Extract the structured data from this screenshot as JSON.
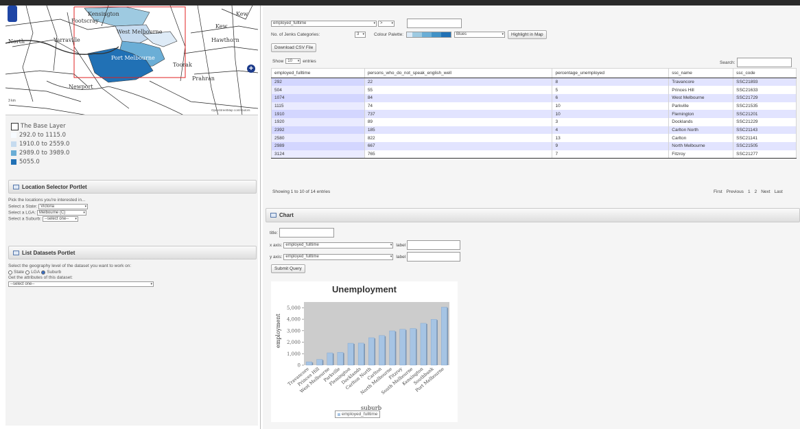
{
  "map": {
    "labels": {
      "kensington": "Kensington",
      "footscray": "Footscray",
      "kew": "Kew",
      "kew2": "Kew",
      "west_melbourne": "West Melbourne",
      "north": "North",
      "yarraville": "Yarraville",
      "hawthorn": "Hawthorn",
      "port_melbourne": "Port Melbourne",
      "toorak": "Toorak",
      "newport": "Newport",
      "prahran": "Prahran"
    },
    "scale_text": "3 km",
    "credit": "OpenStreetMap contributors",
    "zoom_label": "+"
  },
  "legend": {
    "base_layer": "The Base Layer",
    "items": [
      {
        "label": "292.0 to 1115.0",
        "color": "#f7fbff"
      },
      {
        "label": "1910.0 to 2559.0",
        "color": "#c6dbef"
      },
      {
        "label": "2989.0 to 3989.0",
        "color": "#6baed6"
      },
      {
        "label": "5055.0",
        "color": "#2171b5"
      }
    ]
  },
  "location_portlet": {
    "title": "Location Selector Portlet",
    "intro": "Pick the locations you're interested in...",
    "state_label": "Select a State:",
    "state_value": "Victoria",
    "lga_label": "Select a LGA:",
    "lga_value": "Melbourne (C)",
    "suburb_label": "Select a Suburb:",
    "suburb_value": "--select one--"
  },
  "datasets_portlet": {
    "title": "List Datasets Portlet",
    "intro": "Select the geography level of the dataset you want to work on:",
    "radio_state": "State",
    "radio_lga": "LGA",
    "radio_suburb": "Suburb",
    "attributes_label": "Get the attributes of this dataset:",
    "attributes_value": "--select one--"
  },
  "controls": {
    "attribute_value": "employed_fulltime",
    "operator_value": ">",
    "filter_value": "",
    "jenks_label": "No. of Jenks Categories:",
    "jenks_value": "3",
    "palette_label": "Colour Palette:",
    "palette_value": "Blues",
    "palette_colors": [
      "#deebf7",
      "#9ecae1",
      "#6baed6",
      "#4292c6",
      "#2171b5"
    ],
    "highlight_button": "Highlight in Map",
    "download_button": "Download CSV File",
    "show_label": "Show",
    "show_value": "10",
    "entries_label": "entries",
    "search_label": "Search:"
  },
  "table": {
    "columns": [
      "employed_fulltime",
      "persons_who_do_not_speak_english_well",
      "percentage_unemployed",
      "ssc_name",
      "ssc_code"
    ],
    "rows": [
      [
        "292",
        "22",
        "8",
        "Travancore",
        "SSC21893"
      ],
      [
        "504",
        "55",
        "5",
        "Princes Hill",
        "SSC21633"
      ],
      [
        "1074",
        "84",
        "6",
        "West Melbourne",
        "SSC21729"
      ],
      [
        "1115",
        "74",
        "10",
        "Parkville",
        "SSC21535"
      ],
      [
        "1910",
        "737",
        "10",
        "Flemington",
        "SSC21201"
      ],
      [
        "1920",
        "89",
        "3",
        "Docklands",
        "SSC21229"
      ],
      [
        "2392",
        "185",
        "4",
        "Carlton North",
        "SSC21143"
      ],
      [
        "2580",
        "822",
        "13",
        "Carlton",
        "SSC21141"
      ],
      [
        "2989",
        "667",
        "9",
        "North Melbourne",
        "SSC21505"
      ],
      [
        "3124",
        "765",
        "7",
        "Fitzroy",
        "SSC21277"
      ]
    ],
    "info": "Showing 1 to 10 of 14 entries",
    "pagination": {
      "first": "First",
      "previous": "Previous",
      "page1": "1",
      "page2": "2",
      "next": "Next",
      "last": "Last"
    }
  },
  "chart_panel": {
    "title": "Chart",
    "title_label": "title:",
    "title_value": "",
    "xaxis_label": "x axis:",
    "xaxis_value": "employed_fulltime",
    "yaxis_label": "y axis:",
    "yaxis_value": "employed_fulltime",
    "label_text": "label",
    "submit_button": "Submit Query"
  },
  "chart_data": {
    "type": "bar",
    "title": "Unemployment",
    "xlabel": "suburb",
    "ylabel": "employment",
    "ylim": [
      0,
      5500
    ],
    "yticks": [
      "0",
      "1,000",
      "2,000",
      "3,000",
      "4,000",
      "5,000"
    ],
    "categories": [
      "Travancore",
      "Princes Hill",
      "West Melbourne",
      "Parkville",
      "Flemington",
      "Docklands",
      "Carlton North",
      "Carlton",
      "North Melbourne",
      "Fitzroy",
      "South Melbourne",
      "Kensington",
      "Southbank",
      "Port Melbourne"
    ],
    "series": [
      {
        "name": "employed_fulltime",
        "values": [
          292,
          504,
          1074,
          1115,
          1910,
          1920,
          2392,
          2580,
          2989,
          3124,
          3200,
          3650,
          3989,
          5055
        ]
      }
    ],
    "legend_label": "employed_fulltime",
    "bar_color": "#a6c4e4",
    "plot_bg": "#cccccc"
  }
}
